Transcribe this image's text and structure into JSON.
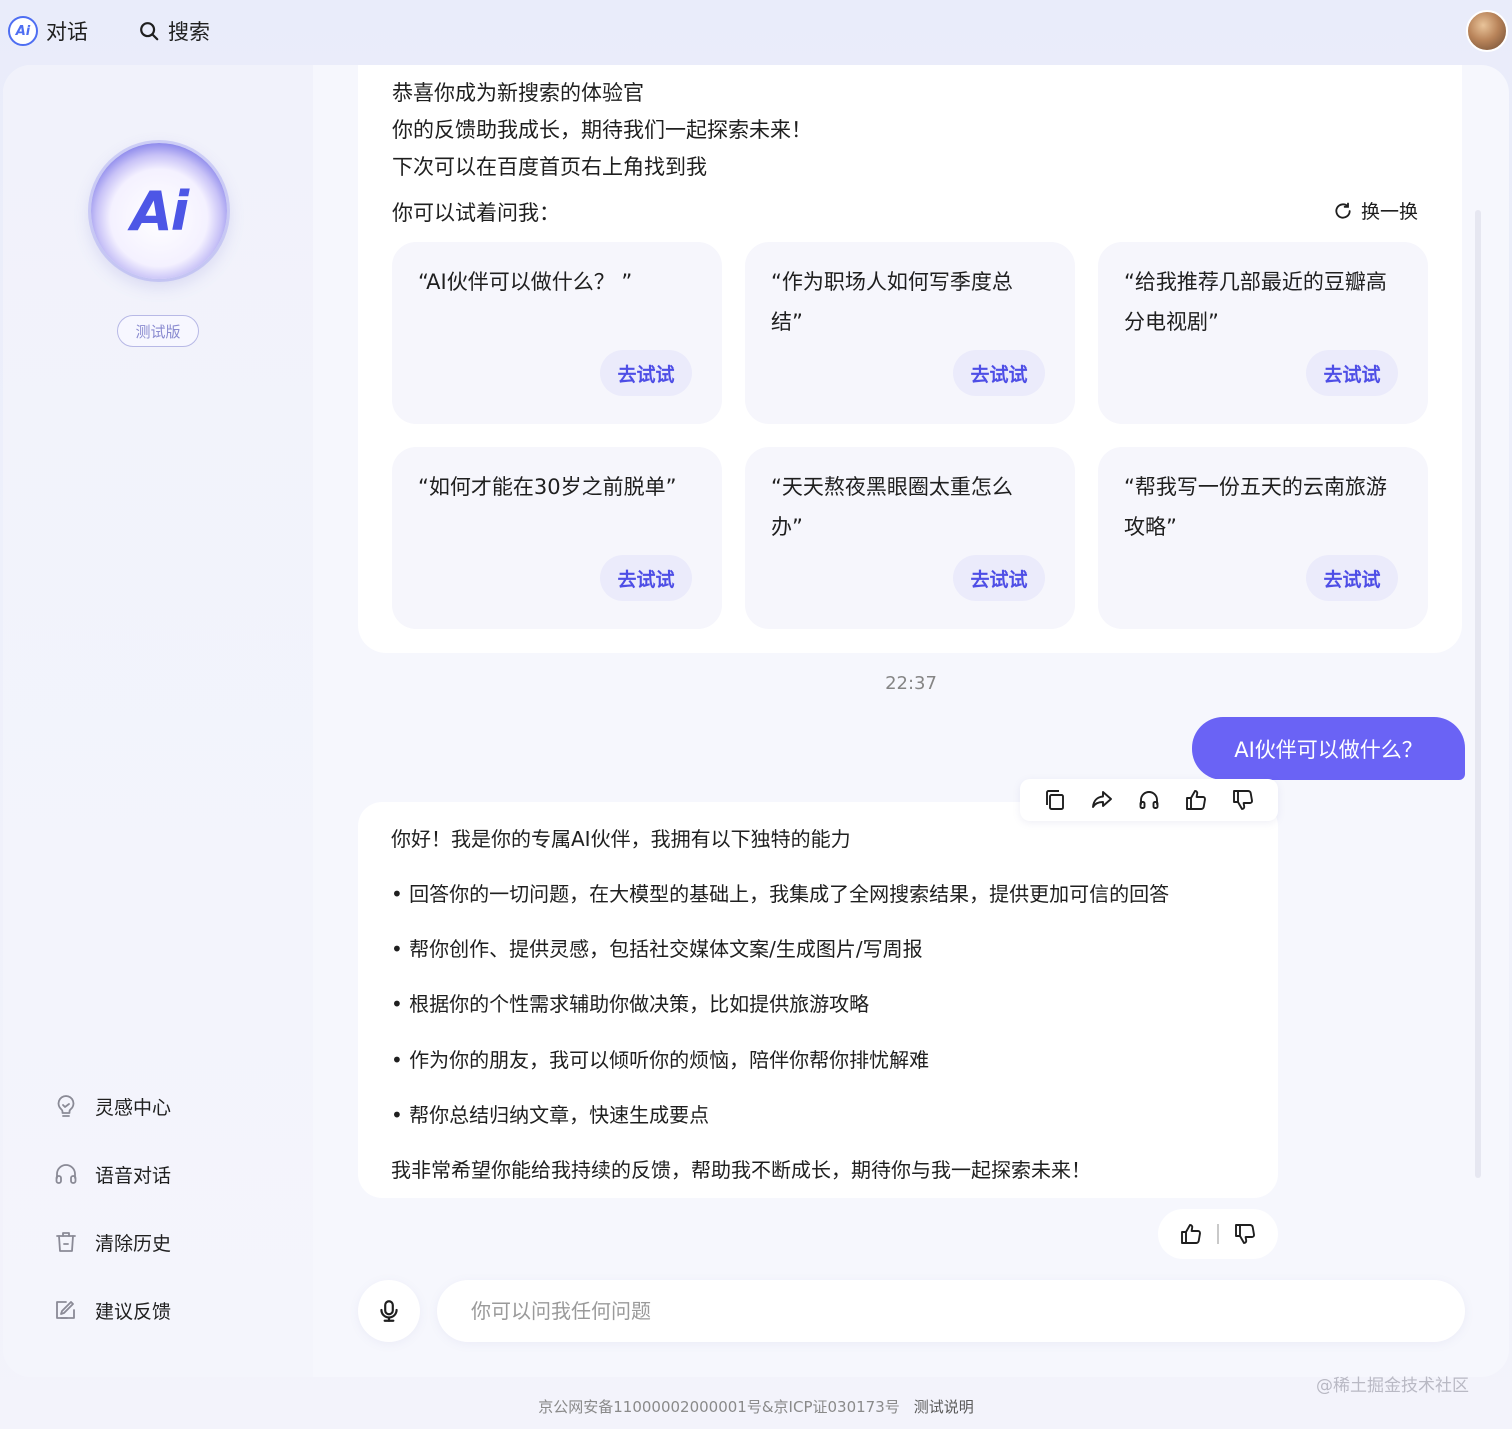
{
  "topbar": {
    "ai_logo_text": "Ai",
    "tab_chat": "对话",
    "tab_search": "搜索"
  },
  "sidebar": {
    "logo_text": "Ai",
    "badge": "测试版",
    "items": [
      {
        "label": "灵感中心",
        "icon": "lightbulb-icon"
      },
      {
        "label": "语音对话",
        "icon": "headphones-icon"
      },
      {
        "label": "清除历史",
        "icon": "trash-icon"
      },
      {
        "label": "建议反馈",
        "icon": "feedback-icon"
      }
    ]
  },
  "welcome": {
    "lines": [
      "恭喜你成为新搜索的体验官",
      "你的反馈助我成长，期待我们一起探索未来！",
      "下次可以在百度首页右上角找到我"
    ],
    "try_prompt": "你可以试着问我：",
    "refresh_label": "换一换",
    "suggestions": [
      {
        "text": "“AI伙伴可以做什么？ ”",
        "button": "去试试"
      },
      {
        "text": "“作为职场人如何写季度总结”",
        "button": "去试试"
      },
      {
        "text": "“给我推荐几部最近的豆瓣高分电视剧”",
        "button": "去试试"
      },
      {
        "text": "“如何才能在30岁之前脱单”",
        "button": "去试试"
      },
      {
        "text": "“天天熬夜黑眼圈太重怎么办”",
        "button": "去试试"
      },
      {
        "text": "“帮我写一份五天的云南旅游攻略”",
        "button": "去试试"
      }
    ]
  },
  "chat": {
    "timestamp": "22:37",
    "user_message": "AI伙伴可以做什么？",
    "answer": {
      "intro": "你好！我是你的专属AI伙伴，我拥有以下独特的能力",
      "bullets": [
        "• 回答你的一切问题，在大模型的基础上，我集成了全网搜索结果，提供更加可信的回答",
        "• 帮你创作、提供灵感，包括社交媒体文案/生成图片/写周报",
        "• 根据你的个性需求辅助你做决策，比如提供旅游攻略",
        "• 作为你的朋友，我可以倾听你的烦恼，陪伴你帮你排忧解难",
        "• 帮你总结归纳文章，快速生成要点"
      ],
      "outro": "我非常希望你能给我持续的反馈，帮助我不断成长，期待你与我一起探索未来！"
    }
  },
  "input": {
    "placeholder": "你可以问我任何问题"
  },
  "footer": {
    "icp": "京公网安备11000002000001号&京ICP证030173号",
    "link": "测试说明",
    "watermark": "@稀土掘金技术社区"
  },
  "colors": {
    "accent": "#6a63f5",
    "try_button_text": "#4e4ee6",
    "background": "#eef0fb"
  }
}
